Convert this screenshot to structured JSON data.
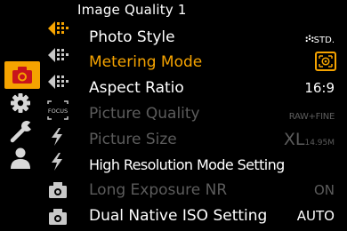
{
  "header": {
    "title": "Image Quality 1"
  },
  "main_menu": [
    {
      "icon": "camera-icon",
      "active": true
    },
    {
      "icon": "gear-icon",
      "active": false
    },
    {
      "icon": "wrench-icon",
      "active": false
    },
    {
      "icon": "person-icon",
      "active": false
    }
  ],
  "sub_tabs": [
    {
      "icon": "image-quality-1-icon",
      "active": true
    },
    {
      "icon": "image-quality-2-icon",
      "active": false
    },
    {
      "icon": "image-quality-3-icon",
      "active": false
    },
    {
      "icon": "focus-tab-icon",
      "label": "FOCUS",
      "active": false
    },
    {
      "icon": "flash-1-icon",
      "active": false
    },
    {
      "icon": "flash-2-icon",
      "active": false
    },
    {
      "icon": "camera-1-icon",
      "active": false
    },
    {
      "icon": "camera-2-icon",
      "active": false
    }
  ],
  "rows": [
    {
      "label": "Photo Style",
      "value": "STD.",
      "state": "normal"
    },
    {
      "label": "Metering Mode",
      "value_icon": "multi-metering-icon",
      "state": "selected"
    },
    {
      "label": "Aspect Ratio",
      "value": "16:9",
      "state": "normal"
    },
    {
      "label": "Picture Quality",
      "value": "RAW+FINE",
      "state": "disabled"
    },
    {
      "label": "Picture Size",
      "value": "XL",
      "value_sub": "14.95M",
      "state": "disabled"
    },
    {
      "label": "High Resolution Mode Setting",
      "value": "",
      "state": "normal"
    },
    {
      "label": "Long Exposure NR",
      "value": "ON",
      "state": "disabled"
    },
    {
      "label": "Dual Native ISO Setting",
      "value": "AUTO",
      "state": "normal"
    }
  ],
  "colors": {
    "accent": "#f5a300",
    "disabled": "#5c5c5c",
    "background": "#000000",
    "text": "#ffffff"
  }
}
